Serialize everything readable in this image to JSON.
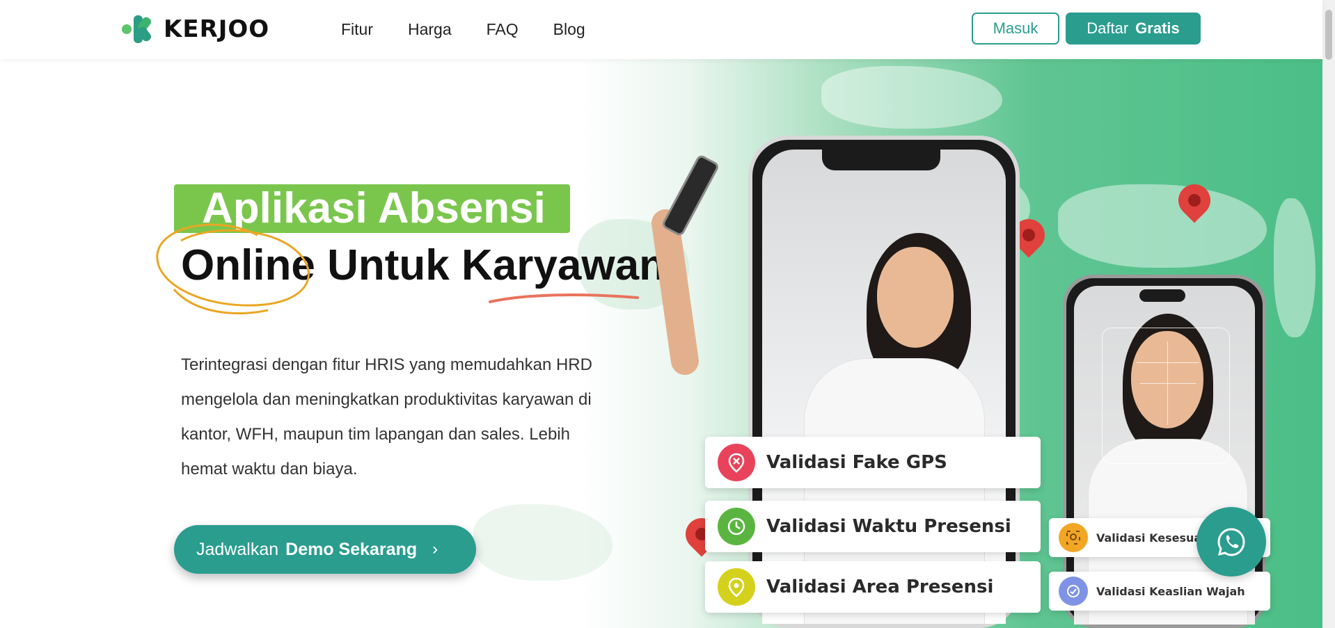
{
  "brand": {
    "name": "KERJOO"
  },
  "nav": {
    "links": [
      "Fitur",
      "Harga",
      "FAQ",
      "Blog"
    ],
    "login_label": "Masuk",
    "signup_label_regular": "Daftar",
    "signup_label_bold": "Gratis"
  },
  "hero": {
    "headline_line1": "Aplikasi Absensi",
    "headline_word1": "Online",
    "headline_word2": "Untuk",
    "headline_word3": "Karyawan",
    "description": "Terintegrasi dengan fitur HRIS yang memudahkan HRD mengelola dan meningkatkan produktivitas karyawan di kantor, WFH, maupun tim lapangan dan sales. Lebih hemat waktu dan biaya.",
    "cta_regular": "Jadwalkan",
    "cta_bold": "Demo Sekarang",
    "cta_chevron": "›"
  },
  "features": [
    {
      "label": "Validasi Fake GPS",
      "icon": "gps-cross-icon",
      "color": "#e8435b"
    },
    {
      "label": "Validasi Waktu Presensi",
      "icon": "clock-icon",
      "color": "#5ab540"
    },
    {
      "label": "Validasi Area Presensi",
      "icon": "location-pin-icon",
      "color": "#d4d11c"
    }
  ],
  "face_features": [
    {
      "label": "Validasi Kesesuai",
      "icon": "face-scan-icon",
      "color": "#f2a623"
    },
    {
      "label": "Validasi Keaslian Wajah",
      "icon": "face-check-icon",
      "color": "#7f93e6"
    }
  ],
  "colors": {
    "primary": "#2a9d8f",
    "headline_highlight": "#7ac64d",
    "scribble_circle": "#eaa623",
    "scribble_underline": "#e9735c"
  }
}
